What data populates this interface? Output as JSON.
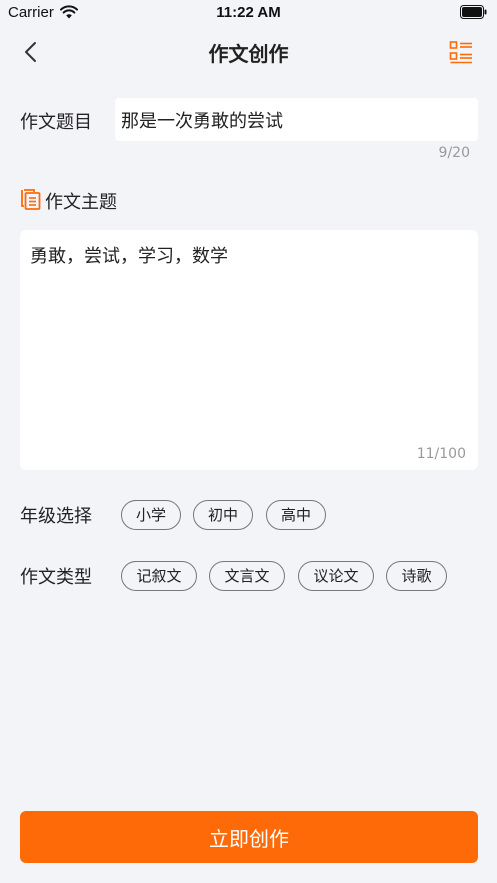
{
  "status_bar": {
    "carrier": "Carrier",
    "time": "11:22 AM"
  },
  "nav": {
    "title": "作文创作",
    "back_icon": "chevron-left-icon",
    "menu_icon": "list-icon"
  },
  "form": {
    "title_label": "作文题目",
    "title_value": "那是一次勇敢的尝试",
    "title_counter": "9/20",
    "theme_label": "作文主题",
    "theme_icon": "document-icon",
    "theme_value": "勇敢，尝试，学习，数学",
    "theme_counter": "11/100",
    "grade_label": "年级选择",
    "grade_options": [
      "小学",
      "初中",
      "高中"
    ],
    "type_label": "作文类型",
    "type_options": [
      "记叙文",
      "文言文",
      "议论文",
      "诗歌"
    ]
  },
  "actions": {
    "submit_label": "立即创作"
  },
  "colors": {
    "accent": "#ff6a08",
    "background": "#f3f4f8"
  }
}
